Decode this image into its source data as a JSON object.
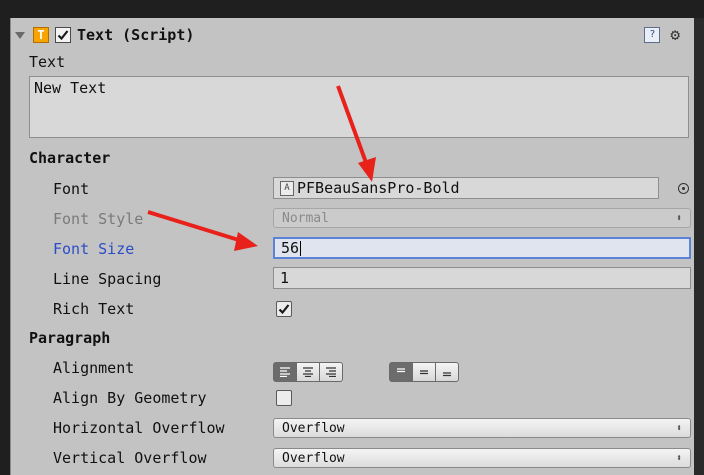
{
  "component": {
    "title": "Text (Script)",
    "icon_letter": "T",
    "enabled": true
  },
  "text_section": {
    "label": "Text",
    "value": "New Text"
  },
  "character": {
    "heading": "Character",
    "font_label": "Font",
    "font_value": "PFBeauSansPro-Bold",
    "font_style_label": "Font Style",
    "font_style_value": "Normal",
    "font_size_label": "Font Size",
    "font_size_value": "56",
    "line_spacing_label": "Line Spacing",
    "line_spacing_value": "1",
    "rich_text_label": "Rich Text",
    "rich_text_checked": true
  },
  "paragraph": {
    "heading": "Paragraph",
    "alignment_label": "Alignment",
    "align_by_geometry_label": "Align By Geometry",
    "align_by_geometry_checked": false,
    "horizontal_overflow_label": "Horizontal Overflow",
    "horizontal_overflow_value": "Overflow",
    "vertical_overflow_label": "Vertical Overflow",
    "vertical_overflow_value": "Overflow"
  },
  "colors": {
    "accent_blue": "#2b4cc8",
    "annotation_arrow": "#e8221a",
    "component_icon": "#f7a400"
  },
  "icons": {
    "help": "help-icon",
    "settings": "gear-icon",
    "object_picker": "target-icon"
  }
}
